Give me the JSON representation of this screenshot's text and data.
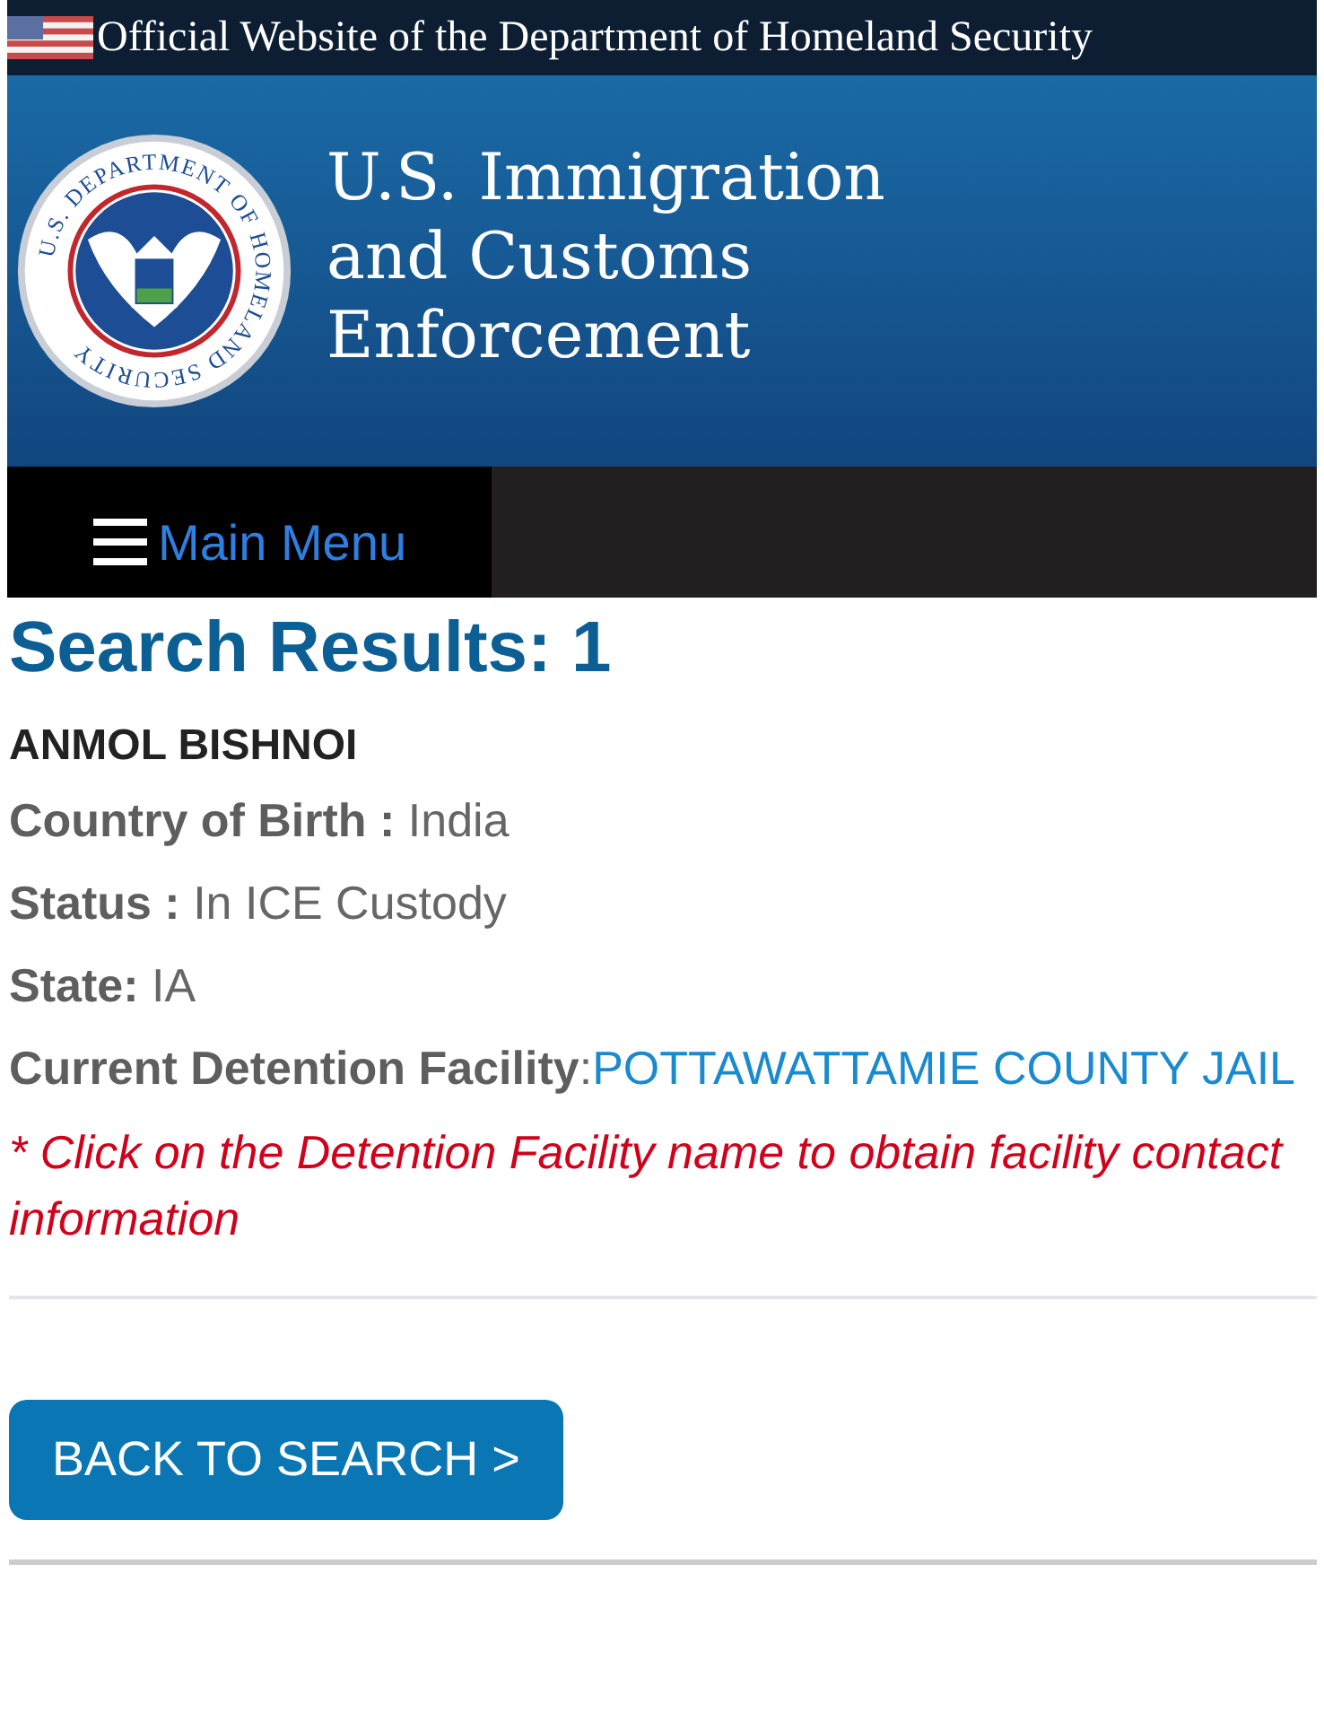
{
  "top_bar": {
    "text": "Official Website of the Department of Homeland Security"
  },
  "header": {
    "seal_text": "U.S. DEPARTMENT OF HOMELAND SECURITY",
    "title_lines": [
      "U.S. Immigration",
      "and Customs",
      "Enforcement"
    ]
  },
  "nav": {
    "menu_label": "Main Menu"
  },
  "results": {
    "heading": "Search Results: 1",
    "name": "ANMOL BISHNOI",
    "fields": [
      {
        "kind": "text",
        "text": "**Country of Birth :** India"
      },
      {
        "kind": "text",
        "text": "**Status :** In ICE Custody"
      },
      {
        "kind": "text",
        "text": "**State:** IA"
      },
      {
        "kind": "link",
        "text": "**Current Detention Facility**:",
        "link": "POTTAWATTAMIE COUNTY JAIL"
      }
    ],
    "note": "* Click on the Detention Facility name to obtain facility contact information"
  },
  "back_button": "BACK TO SEARCH >"
}
